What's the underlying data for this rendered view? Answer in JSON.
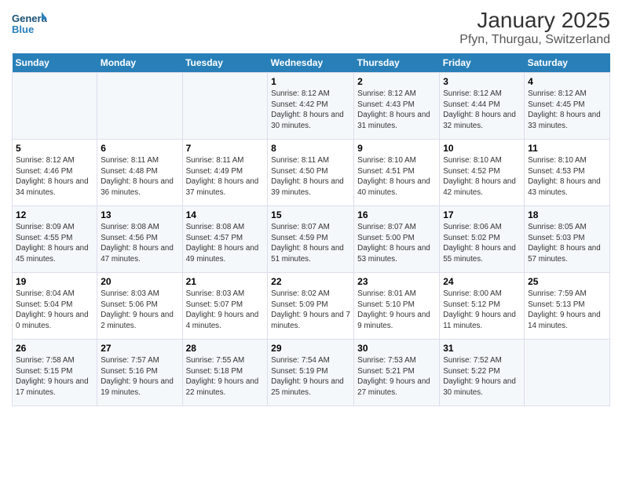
{
  "logo": {
    "text_general": "General",
    "text_blue": "Blue"
  },
  "title": "January 2025",
  "subtitle": "Pfyn, Thurgau, Switzerland",
  "weekdays": [
    "Sunday",
    "Monday",
    "Tuesday",
    "Wednesday",
    "Thursday",
    "Friday",
    "Saturday"
  ],
  "weeks": [
    [
      {
        "num": "",
        "sunrise": "",
        "sunset": "",
        "daylight": ""
      },
      {
        "num": "",
        "sunrise": "",
        "sunset": "",
        "daylight": ""
      },
      {
        "num": "",
        "sunrise": "",
        "sunset": "",
        "daylight": ""
      },
      {
        "num": "1",
        "sunrise": "Sunrise: 8:12 AM",
        "sunset": "Sunset: 4:42 PM",
        "daylight": "Daylight: 8 hours and 30 minutes."
      },
      {
        "num": "2",
        "sunrise": "Sunrise: 8:12 AM",
        "sunset": "Sunset: 4:43 PM",
        "daylight": "Daylight: 8 hours and 31 minutes."
      },
      {
        "num": "3",
        "sunrise": "Sunrise: 8:12 AM",
        "sunset": "Sunset: 4:44 PM",
        "daylight": "Daylight: 8 hours and 32 minutes."
      },
      {
        "num": "4",
        "sunrise": "Sunrise: 8:12 AM",
        "sunset": "Sunset: 4:45 PM",
        "daylight": "Daylight: 8 hours and 33 minutes."
      }
    ],
    [
      {
        "num": "5",
        "sunrise": "Sunrise: 8:12 AM",
        "sunset": "Sunset: 4:46 PM",
        "daylight": "Daylight: 8 hours and 34 minutes."
      },
      {
        "num": "6",
        "sunrise": "Sunrise: 8:11 AM",
        "sunset": "Sunset: 4:48 PM",
        "daylight": "Daylight: 8 hours and 36 minutes."
      },
      {
        "num": "7",
        "sunrise": "Sunrise: 8:11 AM",
        "sunset": "Sunset: 4:49 PM",
        "daylight": "Daylight: 8 hours and 37 minutes."
      },
      {
        "num": "8",
        "sunrise": "Sunrise: 8:11 AM",
        "sunset": "Sunset: 4:50 PM",
        "daylight": "Daylight: 8 hours and 39 minutes."
      },
      {
        "num": "9",
        "sunrise": "Sunrise: 8:10 AM",
        "sunset": "Sunset: 4:51 PM",
        "daylight": "Daylight: 8 hours and 40 minutes."
      },
      {
        "num": "10",
        "sunrise": "Sunrise: 8:10 AM",
        "sunset": "Sunset: 4:52 PM",
        "daylight": "Daylight: 8 hours and 42 minutes."
      },
      {
        "num": "11",
        "sunrise": "Sunrise: 8:10 AM",
        "sunset": "Sunset: 4:53 PM",
        "daylight": "Daylight: 8 hours and 43 minutes."
      }
    ],
    [
      {
        "num": "12",
        "sunrise": "Sunrise: 8:09 AM",
        "sunset": "Sunset: 4:55 PM",
        "daylight": "Daylight: 8 hours and 45 minutes."
      },
      {
        "num": "13",
        "sunrise": "Sunrise: 8:08 AM",
        "sunset": "Sunset: 4:56 PM",
        "daylight": "Daylight: 8 hours and 47 minutes."
      },
      {
        "num": "14",
        "sunrise": "Sunrise: 8:08 AM",
        "sunset": "Sunset: 4:57 PM",
        "daylight": "Daylight: 8 hours and 49 minutes."
      },
      {
        "num": "15",
        "sunrise": "Sunrise: 8:07 AM",
        "sunset": "Sunset: 4:59 PM",
        "daylight": "Daylight: 8 hours and 51 minutes."
      },
      {
        "num": "16",
        "sunrise": "Sunrise: 8:07 AM",
        "sunset": "Sunset: 5:00 PM",
        "daylight": "Daylight: 8 hours and 53 minutes."
      },
      {
        "num": "17",
        "sunrise": "Sunrise: 8:06 AM",
        "sunset": "Sunset: 5:02 PM",
        "daylight": "Daylight: 8 hours and 55 minutes."
      },
      {
        "num": "18",
        "sunrise": "Sunrise: 8:05 AM",
        "sunset": "Sunset: 5:03 PM",
        "daylight": "Daylight: 8 hours and 57 minutes."
      }
    ],
    [
      {
        "num": "19",
        "sunrise": "Sunrise: 8:04 AM",
        "sunset": "Sunset: 5:04 PM",
        "daylight": "Daylight: 9 hours and 0 minutes."
      },
      {
        "num": "20",
        "sunrise": "Sunrise: 8:03 AM",
        "sunset": "Sunset: 5:06 PM",
        "daylight": "Daylight: 9 hours and 2 minutes."
      },
      {
        "num": "21",
        "sunrise": "Sunrise: 8:03 AM",
        "sunset": "Sunset: 5:07 PM",
        "daylight": "Daylight: 9 hours and 4 minutes."
      },
      {
        "num": "22",
        "sunrise": "Sunrise: 8:02 AM",
        "sunset": "Sunset: 5:09 PM",
        "daylight": "Daylight: 9 hours and 7 minutes."
      },
      {
        "num": "23",
        "sunrise": "Sunrise: 8:01 AM",
        "sunset": "Sunset: 5:10 PM",
        "daylight": "Daylight: 9 hours and 9 minutes."
      },
      {
        "num": "24",
        "sunrise": "Sunrise: 8:00 AM",
        "sunset": "Sunset: 5:12 PM",
        "daylight": "Daylight: 9 hours and 11 minutes."
      },
      {
        "num": "25",
        "sunrise": "Sunrise: 7:59 AM",
        "sunset": "Sunset: 5:13 PM",
        "daylight": "Daylight: 9 hours and 14 minutes."
      }
    ],
    [
      {
        "num": "26",
        "sunrise": "Sunrise: 7:58 AM",
        "sunset": "Sunset: 5:15 PM",
        "daylight": "Daylight: 9 hours and 17 minutes."
      },
      {
        "num": "27",
        "sunrise": "Sunrise: 7:57 AM",
        "sunset": "Sunset: 5:16 PM",
        "daylight": "Daylight: 9 hours and 19 minutes."
      },
      {
        "num": "28",
        "sunrise": "Sunrise: 7:55 AM",
        "sunset": "Sunset: 5:18 PM",
        "daylight": "Daylight: 9 hours and 22 minutes."
      },
      {
        "num": "29",
        "sunrise": "Sunrise: 7:54 AM",
        "sunset": "Sunset: 5:19 PM",
        "daylight": "Daylight: 9 hours and 25 minutes."
      },
      {
        "num": "30",
        "sunrise": "Sunrise: 7:53 AM",
        "sunset": "Sunset: 5:21 PM",
        "daylight": "Daylight: 9 hours and 27 minutes."
      },
      {
        "num": "31",
        "sunrise": "Sunrise: 7:52 AM",
        "sunset": "Sunset: 5:22 PM",
        "daylight": "Daylight: 9 hours and 30 minutes."
      },
      {
        "num": "",
        "sunrise": "",
        "sunset": "",
        "daylight": ""
      }
    ]
  ]
}
